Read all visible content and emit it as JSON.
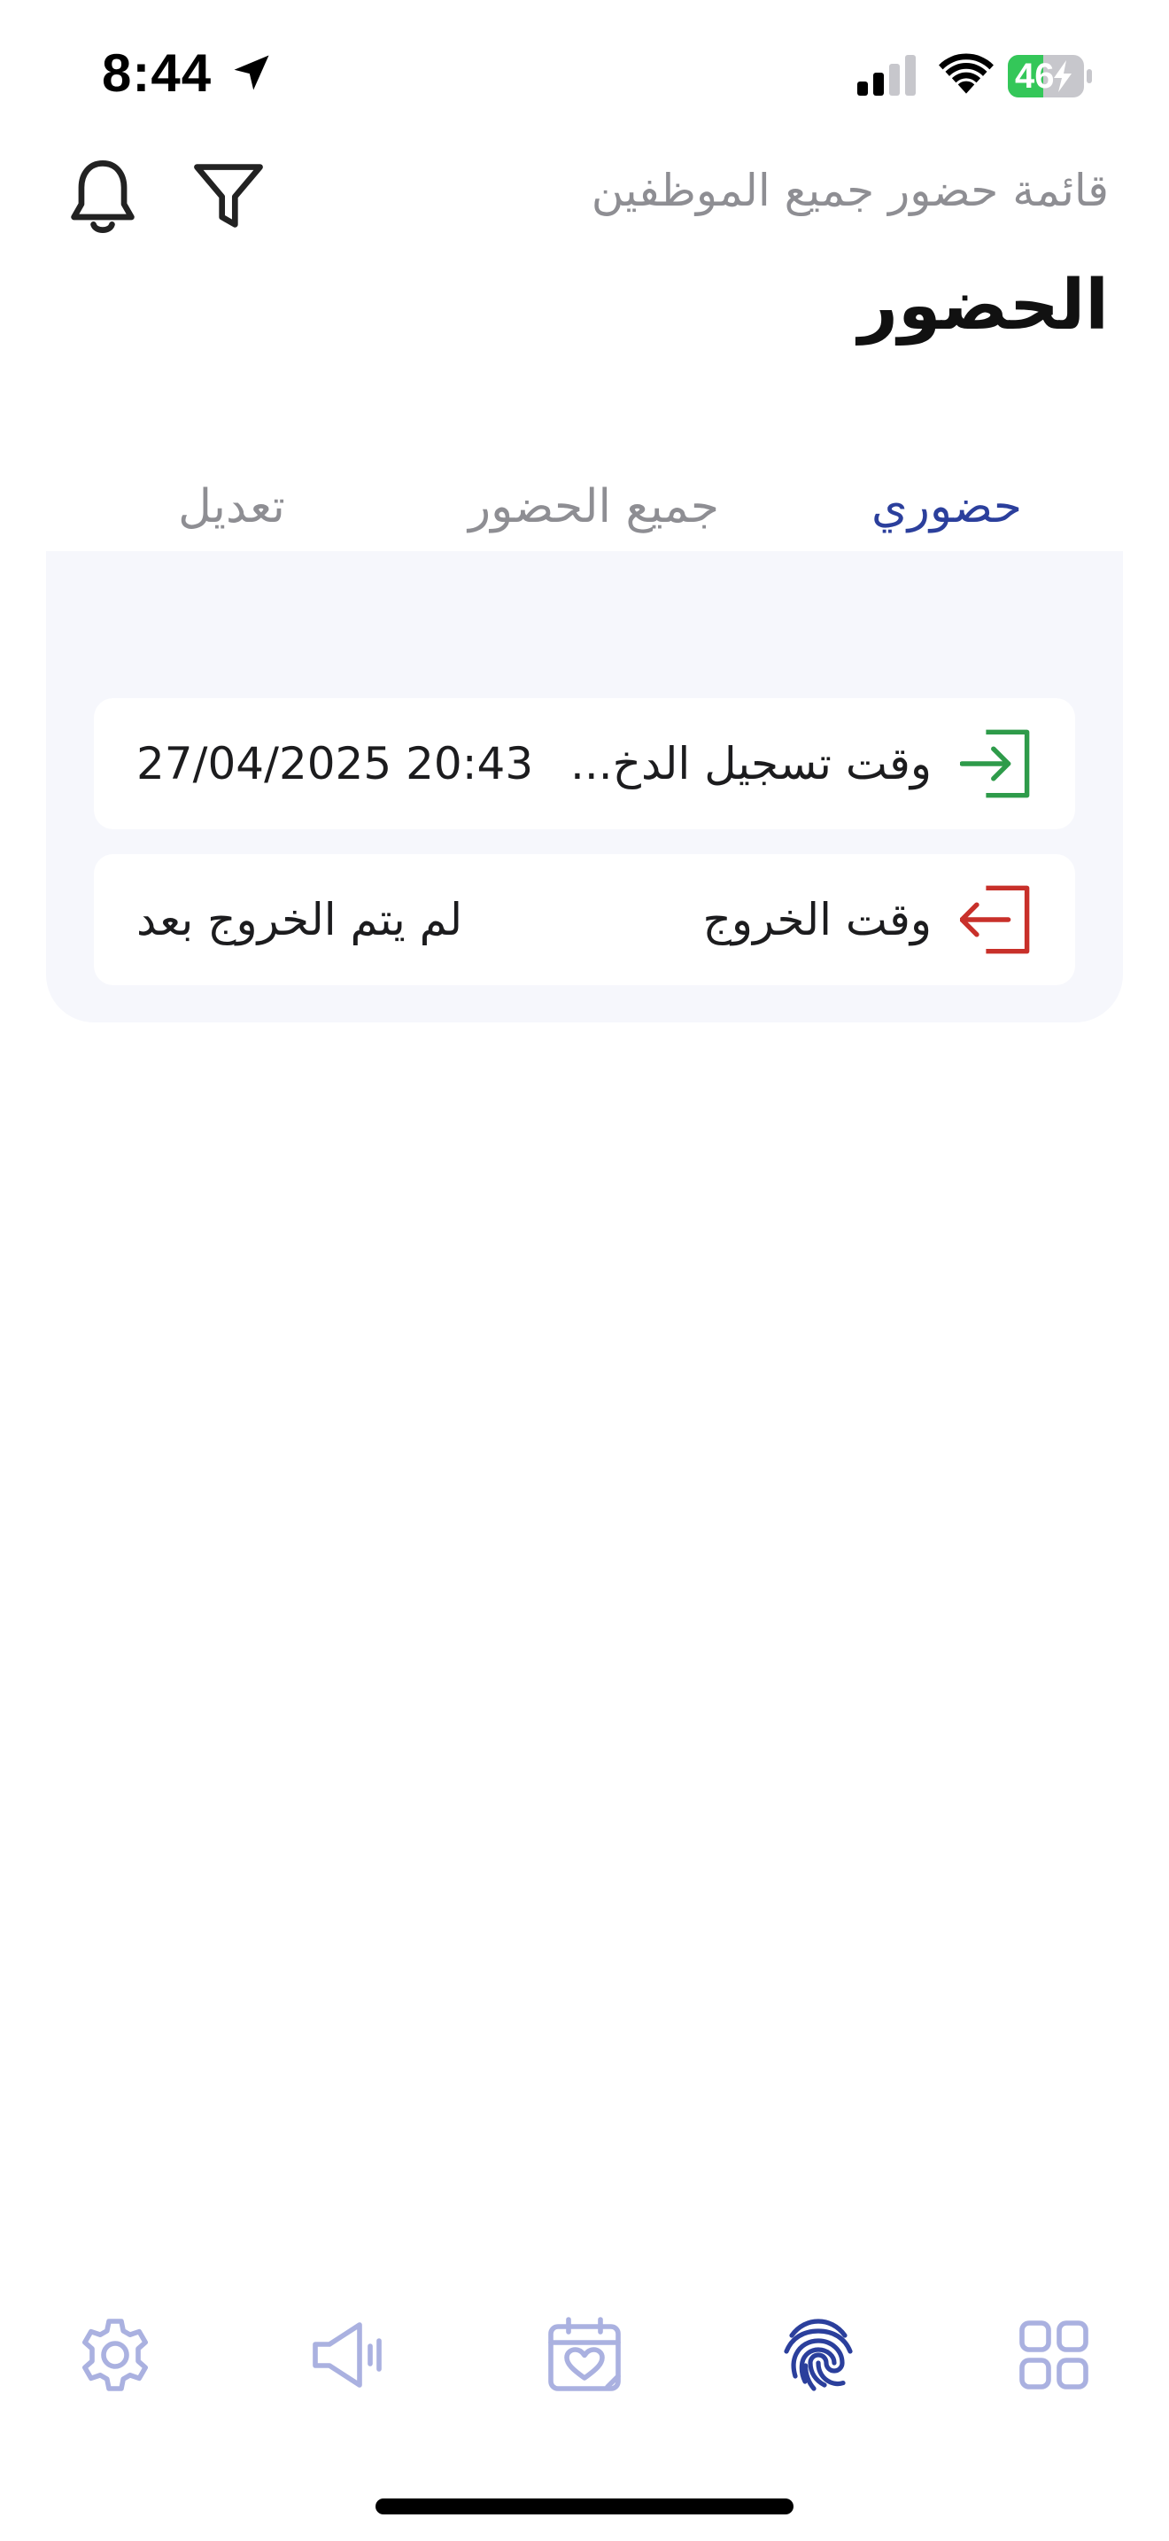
{
  "status_bar": {
    "time": "8:44",
    "battery": "46",
    "location_icon": "location-arrow-icon",
    "signal_icon": "cellular-signal-icon",
    "wifi_icon": "wifi-icon",
    "battery_icon": "battery-charging-icon",
    "battery_color": "#34c759"
  },
  "header": {
    "subtitle": "قائمة حضور جميع الموظفين",
    "title": "الحضور",
    "bell_icon": "bell-icon",
    "filter_icon": "filter-icon"
  },
  "tabs": [
    {
      "label": "حضوري",
      "active": true
    },
    {
      "label": "جميع الحضور",
      "active": false
    },
    {
      "label": "تعديل",
      "active": false
    }
  ],
  "attendance": {
    "check_in": {
      "label": "وقت تسجيل الدخ...",
      "value": "27/04/2025 20:43",
      "icon": "check-in-icon",
      "icon_color": "#2e9b4a"
    },
    "check_out": {
      "label": "وقت الخروج",
      "value": "لم يتم الخروج بعد",
      "icon": "check-out-icon",
      "icon_color": "#c8302a"
    }
  },
  "bottom_nav": [
    {
      "name": "settings",
      "icon": "gear-icon",
      "active": false
    },
    {
      "name": "announcements",
      "icon": "megaphone-icon",
      "active": false
    },
    {
      "name": "calendar",
      "icon": "calendar-heart-icon",
      "active": false
    },
    {
      "name": "attendance",
      "icon": "fingerprint-icon",
      "active": true
    },
    {
      "name": "home",
      "icon": "grid-icon",
      "active": false
    }
  ],
  "colors": {
    "accent": "#2b3f9c",
    "inactive_nav": "#aab1e0",
    "inactive_tab": "#8e8e93",
    "card_background": "#f6f7fc"
  }
}
